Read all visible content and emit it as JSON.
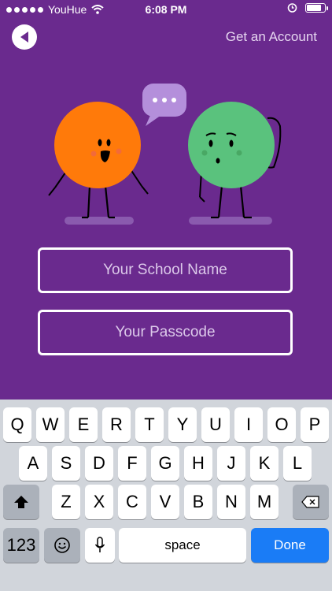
{
  "status_bar": {
    "carrier": "YouHue",
    "time": "6:08 PM",
    "battery_level": 0.9
  },
  "header": {
    "get_account_label": "Get an Account"
  },
  "form": {
    "school_placeholder": "Your School Name",
    "passcode_placeholder": "Your Passcode"
  },
  "colors": {
    "background": "#6a2a8e",
    "orange_character": "#ff7a0a",
    "green_character": "#5ac27d",
    "speech_bubble": "#b48fdb",
    "done_key": "#1a7cf6"
  },
  "keyboard": {
    "row1": [
      "Q",
      "W",
      "E",
      "R",
      "T",
      "Y",
      "U",
      "I",
      "O",
      "P"
    ],
    "row2": [
      "A",
      "S",
      "D",
      "F",
      "G",
      "H",
      "J",
      "K",
      "L"
    ],
    "row3": [
      "Z",
      "X",
      "C",
      "V",
      "B",
      "N",
      "M"
    ],
    "numbers_label": "123",
    "space_label": "space",
    "done_label": "Done"
  }
}
